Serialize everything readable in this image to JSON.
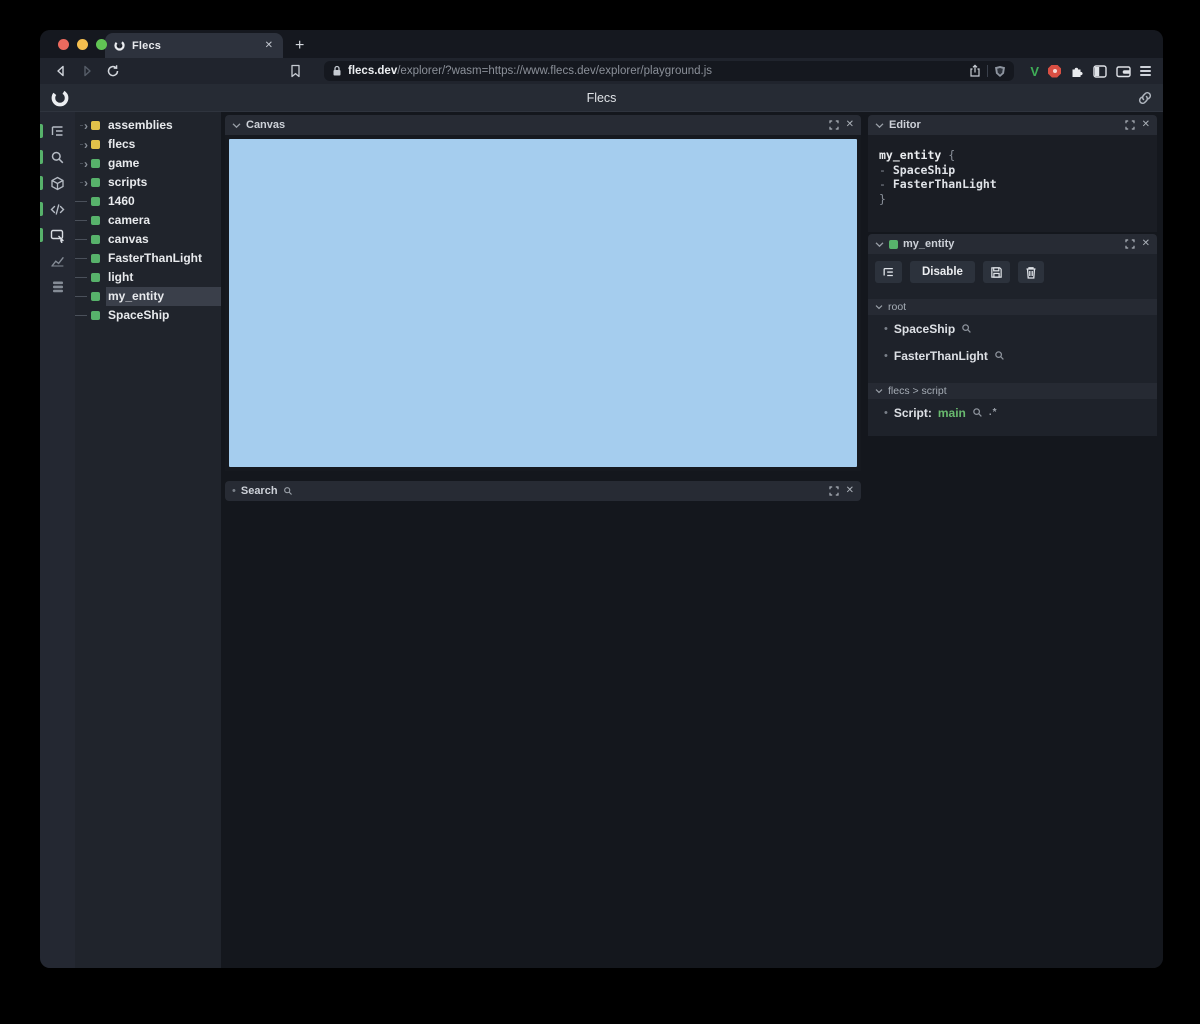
{
  "browser": {
    "tab": {
      "title": "Flecs",
      "close_glyph": "✕",
      "new_tab_glyph": "+"
    },
    "url": {
      "domain": "flecs.dev",
      "path": "/explorer/?wasm=https://www.flecs.dev/explorer/playground.js"
    },
    "extensions": {
      "vimium_label": "V"
    }
  },
  "header": {
    "title": "Flecs"
  },
  "glyphs": {
    "chevron_right": "›",
    "bullet": "•",
    "close": "✕"
  },
  "colors": {
    "canvas_blue": "#a5cdee",
    "entity_green": "#57b26b",
    "module_yellow": "#e2c24a",
    "selection": "#3a3f4a",
    "script_value_green": "#68b96e"
  },
  "tree": {
    "items": [
      {
        "label": "assemblies",
        "square": "#e2c24a",
        "expandable": true,
        "selected": false
      },
      {
        "label": "flecs",
        "square": "#e2c24a",
        "expandable": true,
        "selected": false
      },
      {
        "label": "game",
        "square": "#57b26b",
        "expandable": true,
        "selected": false
      },
      {
        "label": "scripts",
        "square": "#57b26b",
        "expandable": true,
        "selected": false
      },
      {
        "label": "1460",
        "square": "#57b26b",
        "expandable": false,
        "selected": false
      },
      {
        "label": "camera",
        "square": "#57b26b",
        "expandable": false,
        "selected": false
      },
      {
        "label": "canvas",
        "square": "#57b26b",
        "expandable": false,
        "selected": false
      },
      {
        "label": "FasterThanLight",
        "square": "#57b26b",
        "expandable": false,
        "selected": false
      },
      {
        "label": "light",
        "square": "#57b26b",
        "expandable": false,
        "selected": false
      },
      {
        "label": "my_entity",
        "square": "#57b26b",
        "expandable": false,
        "selected": true
      },
      {
        "label": "SpaceShip",
        "square": "#57b26b",
        "expandable": false,
        "selected": false
      }
    ]
  },
  "panels": {
    "canvas": {
      "title": "Canvas"
    },
    "search": {
      "title": "Search"
    },
    "editor": {
      "title": "Editor",
      "lines": [
        [
          {
            "text": "my_entity",
            "cls": "ident"
          },
          {
            "text": " {",
            "cls": "punct"
          }
        ],
        [
          {
            "text": "  - ",
            "cls": "punct"
          },
          {
            "text": "SpaceShip",
            "cls": "comp"
          }
        ],
        [
          {
            "text": "  - ",
            "cls": "punct"
          },
          {
            "text": "FasterThanLight",
            "cls": "comp"
          }
        ],
        [
          {
            "text": "}",
            "cls": "punct"
          }
        ]
      ]
    },
    "inspector": {
      "title": "my_entity",
      "buttons": {
        "disable": "Disable"
      },
      "sections": [
        {
          "title": "root",
          "items": [
            {
              "text": "SpaceShip",
              "search_icon": true
            },
            {
              "text": "FasterThanLight",
              "search_icon": true
            }
          ]
        },
        {
          "title": "flecs > script",
          "items": [
            {
              "text": "Script: ",
              "value": "main",
              "search_icon": true,
              "regex": ".*"
            }
          ]
        }
      ]
    }
  }
}
